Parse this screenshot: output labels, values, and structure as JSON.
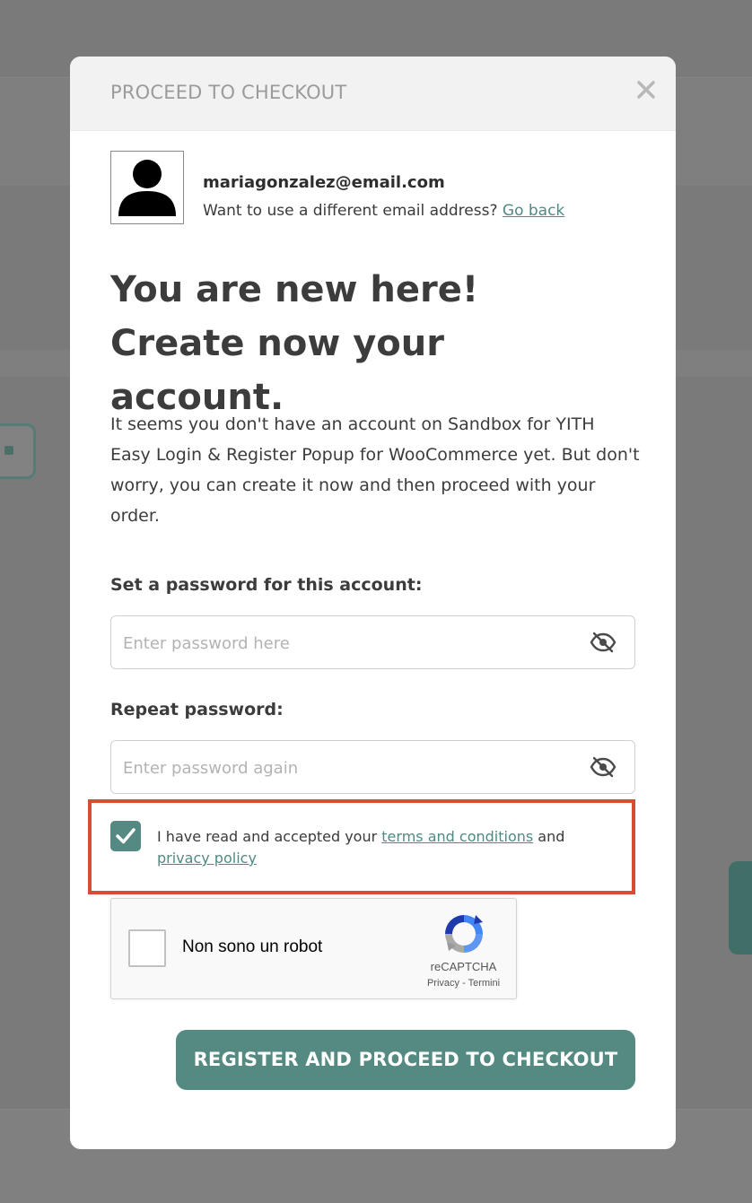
{
  "modal": {
    "title": "PROCEED TO CHECKOUT",
    "close_icon": "close-icon"
  },
  "account": {
    "avatar_icon": "user-silhouette-icon",
    "email": "mariagonzalez@email.com",
    "different_email_text": "Want to use a different email address?",
    "go_back_label": "Go back"
  },
  "headline": "You are new here! Create now your account.",
  "description": "It seems you don't have an account on Sandbox for YITH Easy Login & Register Popup for WooCommerce yet. But don't worry, you can create it now and then proceed with your order.",
  "password": {
    "label": "Set a password for this account:",
    "placeholder": "Enter password here",
    "value": "",
    "toggle_icon": "eye-slash-icon"
  },
  "repeat_password": {
    "label": "Repeat password:",
    "placeholder": "Enter password again",
    "value": "",
    "toggle_icon": "eye-slash-icon"
  },
  "consent": {
    "checked": true,
    "text_before": "I have read and accepted your",
    "terms_label": "terms and conditions",
    "text_middle": "and",
    "privacy_label": "privacy policy"
  },
  "recaptcha": {
    "label": "Non sono un robot",
    "brand": "reCAPTCHA",
    "privacy_label": "Privacy",
    "separator": "-",
    "terms_label": "Termini"
  },
  "submit_label": "REGISTER AND PROCEED TO CHECKOUT",
  "colors": {
    "accent": "#558a82",
    "highlight_border": "#d94b33",
    "overlay": "#7a7a7a"
  }
}
